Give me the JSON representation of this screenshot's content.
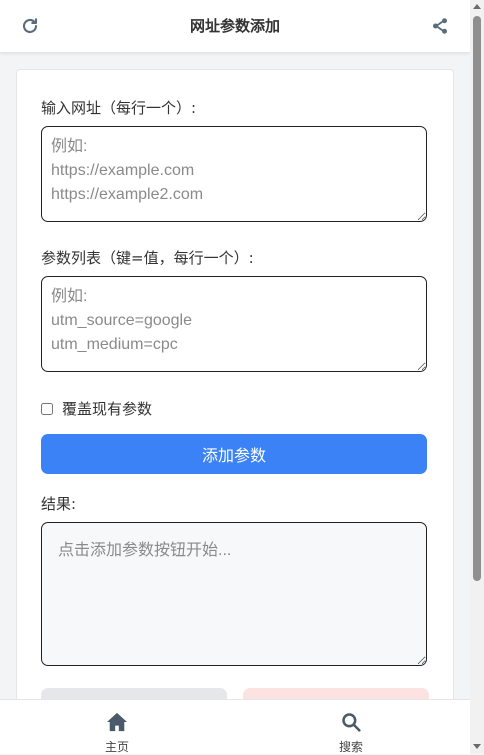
{
  "header": {
    "title": "网址参数添加",
    "left_icon": "refresh-icon",
    "right_icon": "share-icon"
  },
  "form": {
    "urls_label": "输入网址（每行一个）:",
    "urls_placeholder": "例如:\nhttps://example.com\nhttps://example2.com",
    "urls_value": "",
    "params_label": "参数列表（键=值，每行一个）:",
    "params_placeholder": "例如:\nutm_source=google\nutm_medium=cpc",
    "params_value": "",
    "overwrite_label": "覆盖现有参数",
    "overwrite_checked": false,
    "add_button": "添加参数",
    "result_label": "结果:",
    "result_placeholder": "点击添加参数按钮开始...",
    "result_value": ""
  },
  "bottom_nav": {
    "items": [
      {
        "label": "主页",
        "icon": "home-icon"
      },
      {
        "label": "搜索",
        "icon": "search-icon"
      }
    ]
  },
  "colors": {
    "primary": "#3b82f6",
    "danger_light": "#fde2e2",
    "neutral_light": "#e5e7eb"
  }
}
